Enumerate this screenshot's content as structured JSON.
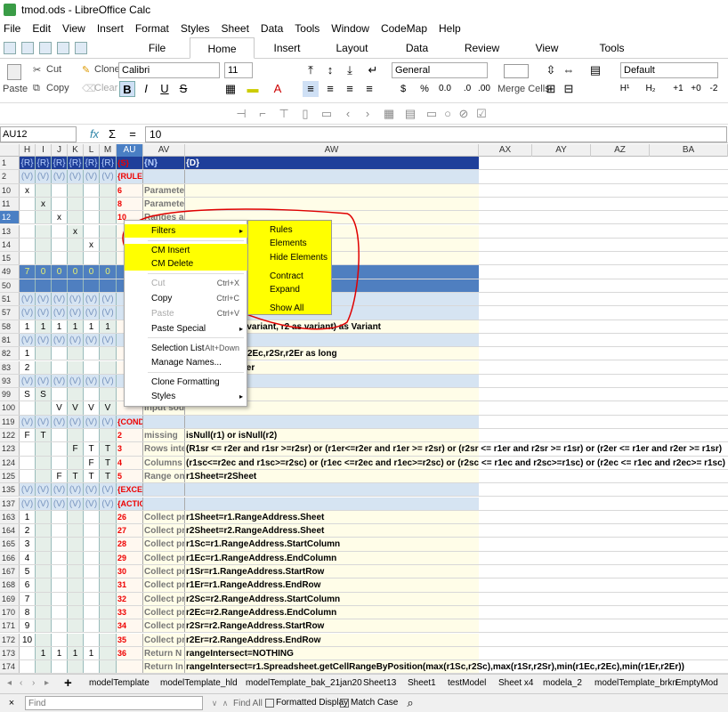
{
  "window": {
    "title": "tmod.ods - LibreOffice Calc"
  },
  "menu": [
    "File",
    "Edit",
    "View",
    "Insert",
    "Format",
    "Styles",
    "Sheet",
    "Data",
    "Tools",
    "Window",
    "CodeMap",
    "Help"
  ],
  "tabs": [
    "File",
    "Home",
    "Insert",
    "Layout",
    "Data",
    "Review",
    "View",
    "Tools"
  ],
  "active_tab": "Home",
  "ribbon": {
    "paste": "Paste",
    "cut": "Cut",
    "copy": "Copy",
    "clone": "Clone",
    "clear": "Clear",
    "font_name": "Calibri",
    "font_size": "11",
    "number_format": "General",
    "style": "Default",
    "merge_cells": "Merge Cells",
    "bold": "B",
    "italic": "I",
    "underline": "U",
    "strike": "S",
    "currency": "$",
    "percent": "%",
    "decimal": "0.0",
    "superscript": "H¹",
    "subscript": "H₂",
    "inc_indent": "+1",
    "dec_indent": "+0",
    "del_decimal": "-2"
  },
  "formula_bar": {
    "cell": "AU12",
    "value": "10",
    "fx": "fx",
    "sum": "Σ",
    "eq": "="
  },
  "columns": [
    "H",
    "I",
    "J",
    "K",
    "L",
    "M",
    "AU",
    "AV",
    "AW",
    "AX",
    "AY",
    "AZ",
    "BA"
  ],
  "rows": [
    {
      "n": "1",
      "cells": [
        "{R}",
        "{R}",
        "{R}",
        "{R}",
        "{R}",
        "{R}"
      ],
      "au": "{S}",
      "av": "{N}",
      "aw": "{D}",
      "style": "blue"
    },
    {
      "n": "2",
      "cells": [
        "(V)",
        "(V)",
        "(V)",
        "(V)",
        "(V)",
        "(V)"
      ],
      "au": "{RULE}",
      "av": "",
      "aw": "",
      "style": "gray"
    },
    {
      "n": "10",
      "cells": [
        "x",
        "",
        "",
        "",
        "",
        ""
      ],
      "au": "6",
      "av": "Parameters all present",
      "aw": "",
      "style": "plain"
    },
    {
      "n": "11",
      "cells": [
        "",
        "x",
        "",
        "",
        "",
        ""
      ],
      "au": "8",
      "av": "Parameter missing",
      "aw": "",
      "style": "plain"
    },
    {
      "n": "12",
      "cells": [
        "",
        "",
        "x",
        "",
        "",
        ""
      ],
      "au": "10",
      "av": "Ranges are on different sheets",
      "aw": "",
      "style": "plain",
      "sel": true
    },
    {
      "n": "13",
      "cells": [
        "",
        "",
        "",
        "x",
        "",
        ""
      ],
      "au": "",
      "av": "",
      "aw": "",
      "style": "plain"
    },
    {
      "n": "14",
      "cells": [
        "",
        "",
        "",
        "",
        "x",
        ""
      ],
      "au": "",
      "av": "",
      "aw": "",
      "style": "plain"
    },
    {
      "n": "15",
      "cells": [
        "",
        "",
        "",
        "",
        "",
        ""
      ],
      "au": "",
      "av": "",
      "aw": "",
      "style": "plain"
    },
    {
      "n": "49",
      "cells": [
        "7",
        "0",
        "0",
        "0",
        "0",
        "0"
      ],
      "au": "",
      "av": "",
      "aw": "",
      "style": "mid"
    },
    {
      "n": "50",
      "cells": [
        "",
        "",
        "",
        "",
        "",
        ""
      ],
      "au": "",
      "av": "",
      "aw": "",
      "style": "mid"
    },
    {
      "n": "51",
      "cells": [
        "(V)",
        "(V)",
        "(V)",
        "(V)",
        "(V)",
        "(V)"
      ],
      "au": "",
      "av": "",
      "aw": "",
      "style": "gray"
    },
    {
      "n": "57",
      "cells": [
        "(V)",
        "(V)",
        "(V)",
        "(V)",
        "(V)",
        "(V)"
      ],
      "au": "",
      "av": "",
      "aw": "",
      "style": "gray"
    },
    {
      "n": "58",
      "cells": [
        "1",
        "1",
        "1",
        "1",
        "1",
        "1"
      ],
      "au": "",
      "av": "",
      "aw": "ntersect(r1 as variant, r2 as variant) as Variant",
      "style": "plain"
    },
    {
      "n": "81",
      "cells": [
        "(V)",
        "(V)",
        "(V)",
        "(V)",
        "(V)",
        "(V)"
      ],
      "au": "",
      "av": "",
      "aw": "",
      "style": "gray"
    },
    {
      "n": "82",
      "cells": [
        "1",
        "",
        "",
        "",
        "",
        ""
      ],
      "au": "",
      "av": "",
      "aw": "1Sr,r1Er,r2Sc,r2Ec,r2Sr,r2Er as long",
      "style": "plain"
    },
    {
      "n": "83",
      "cells": [
        "2",
        "",
        "",
        "",
        "",
        ""
      ],
      "au": "",
      "av": "",
      "aw": "Sheet as integer",
      "style": "plain"
    },
    {
      "n": "93",
      "cells": [
        "(V)",
        "(V)",
        "(V)",
        "(V)",
        "(V)",
        "(V)"
      ],
      "au": "",
      "av": "",
      "aw": "",
      "style": "gray"
    },
    {
      "n": "99",
      "cells": [
        "S",
        "S",
        "",
        "",
        "",
        ""
      ],
      "au": "",
      "av": "",
      "aw": "",
      "style": "plain"
    },
    {
      "n": "100",
      "cells": [
        "",
        "",
        "V",
        "V",
        "V",
        "V"
      ],
      "au": "",
      "av": "Input sound; evaluate ranges",
      "aw": "",
      "style": "plain"
    },
    {
      "n": "119",
      "cells": [
        "(V)",
        "(V)",
        "(V)",
        "(V)",
        "(V)",
        "(V)"
      ],
      "au": "{CONDITION}",
      "av": "",
      "aw": "",
      "style": "gray"
    },
    {
      "n": "122",
      "cells": [
        "F",
        "T",
        "",
        "",
        "",
        ""
      ],
      "au": "2",
      "av": "missing",
      "aw": "isNull(r1) or isNull(r2)",
      "style": "plain"
    },
    {
      "n": "123",
      "cells": [
        "",
        "",
        "",
        "F",
        "T",
        "T"
      ],
      "au": "3",
      "av": "Rows inte",
      "aw": "(R1sr <= r2er and r1sr >=r2sr) or (r1er<=r2er and r1er >= r2sr) or (r2sr <= r1er and r2sr >= r1sr) or (r2er <= r1er and r2er >= r1sr)",
      "style": "plain"
    },
    {
      "n": "124",
      "cells": [
        "",
        "",
        "",
        "",
        "F",
        "T"
      ],
      "au": "4",
      "av": "Columns",
      "aw": "(r1sc<=r2ec and r1sc>=r2sc) or (r1ec <=r2ec and r1ec>=r2sc) or (r2sc <= r1ec and r2sc>=r1sc) or (r2ec <= r1ec and r2ec>= r1sc)",
      "style": "plain"
    },
    {
      "n": "125",
      "cells": [
        "",
        "",
        "F",
        "T",
        "T",
        "T"
      ],
      "au": "5",
      "av": "Range on",
      "aw": "r1Sheet=r2Sheet",
      "style": "plain"
    },
    {
      "n": "135",
      "cells": [
        "(V)",
        "(V)",
        "(V)",
        "(V)",
        "(V)",
        "(V)"
      ],
      "au": "{EXCEPTION}",
      "av": "",
      "aw": "",
      "style": "gray"
    },
    {
      "n": "137",
      "cells": [
        "(V)",
        "(V)",
        "(V)",
        "(V)",
        "(V)",
        "(V)"
      ],
      "au": "{ACTION}",
      "av": "",
      "aw": "",
      "style": "gray"
    },
    {
      "n": "163",
      "cells": [
        "1",
        "",
        "",
        "",
        "",
        ""
      ],
      "au": "26",
      "av": "Collect pr",
      "aw": "r1Sheet=r1.RangeAddress.Sheet",
      "style": "plain"
    },
    {
      "n": "164",
      "cells": [
        "2",
        "",
        "",
        "",
        "",
        ""
      ],
      "au": "27",
      "av": "Collect pr",
      "aw": "r2Sheet=r2.RangeAddress.Sheet",
      "style": "plain"
    },
    {
      "n": "165",
      "cells": [
        "3",
        "",
        "",
        "",
        "",
        ""
      ],
      "au": "28",
      "av": "Collect pr",
      "aw": "r1Sc=r1.RangeAddress.StartColumn",
      "style": "plain"
    },
    {
      "n": "166",
      "cells": [
        "4",
        "",
        "",
        "",
        "",
        ""
      ],
      "au": "29",
      "av": "Collect pr",
      "aw": "r1Ec=r1.RangeAddress.EndColumn",
      "style": "plain"
    },
    {
      "n": "167",
      "cells": [
        "5",
        "",
        "",
        "",
        "",
        ""
      ],
      "au": "30",
      "av": "Collect pr",
      "aw": "r1Sr=r1.RangeAddress.StartRow",
      "style": "plain"
    },
    {
      "n": "168",
      "cells": [
        "6",
        "",
        "",
        "",
        "",
        ""
      ],
      "au": "31",
      "av": "Collect pr",
      "aw": "r1Er=r1.RangeAddress.EndRow",
      "style": "plain"
    },
    {
      "n": "169",
      "cells": [
        "7",
        "",
        "",
        "",
        "",
        ""
      ],
      "au": "32",
      "av": "Collect pr",
      "aw": "r2Sc=r2.RangeAddress.StartColumn",
      "style": "plain"
    },
    {
      "n": "170",
      "cells": [
        "8",
        "",
        "",
        "",
        "",
        ""
      ],
      "au": "33",
      "av": "Collect pr",
      "aw": "r2Ec=r2.RangeAddress.EndColumn",
      "style": "plain"
    },
    {
      "n": "171",
      "cells": [
        "9",
        "",
        "",
        "",
        "",
        ""
      ],
      "au": "34",
      "av": "Collect pr",
      "aw": "r2Sr=r2.RangeAddress.StartRow",
      "style": "plain"
    },
    {
      "n": "172",
      "cells": [
        "10",
        "",
        "",
        "",
        "",
        ""
      ],
      "au": "35",
      "av": "Collect pr",
      "aw": "r2Er=r2.RangeAddress.EndRow",
      "style": "plain"
    },
    {
      "n": "173",
      "cells": [
        "",
        "1",
        "1",
        "1",
        "1",
        ""
      ],
      "au": "36",
      "av": "Return N",
      "aw": "rangeIntersect=NOTHING",
      "style": "plain"
    },
    {
      "n": "174",
      "cells": [
        "",
        "",
        "",
        "",
        "",
        ""
      ],
      "au": "",
      "av": "Return In",
      "aw": "rangeIntersect=r1.Spreadsheet.getCellRangeByPosition(max(r1Sc,r2Sc),max(r1Sr,r2Sr),min(r1Ec,r2Ec),min(r1Er,r2Er))",
      "style": "plain"
    }
  ],
  "context_menu": {
    "items": [
      {
        "label": "Filters",
        "shortcut": "",
        "sub": true,
        "hl": true
      },
      {
        "label": "CM Insert",
        "shortcut": "",
        "sub": false,
        "hl": true
      },
      {
        "label": "CM Delete",
        "shortcut": "",
        "sub": false,
        "hl": true
      },
      {
        "label": "Cut",
        "shortcut": "Ctrl+X",
        "sub": false,
        "dis": true
      },
      {
        "label": "Copy",
        "shortcut": "Ctrl+C",
        "sub": false
      },
      {
        "label": "Paste",
        "shortcut": "Ctrl+V",
        "sub": false,
        "dis": true
      },
      {
        "label": "Paste Special",
        "shortcut": "",
        "sub": true
      },
      {
        "label": "Selection List",
        "shortcut": "Alt+Down",
        "sub": false
      },
      {
        "label": "Manage Names...",
        "shortcut": "",
        "sub": false
      },
      {
        "label": "Clone Formatting",
        "shortcut": "",
        "sub": false
      },
      {
        "label": "Styles",
        "shortcut": "",
        "sub": true
      }
    ]
  },
  "submenu": [
    "Rules",
    "Elements",
    "Hide Elements",
    "Contract",
    "Expand",
    "Show All"
  ],
  "sheet_tabs": [
    "modelTemplate",
    "modelTemplate_hld",
    "modelTemplate_bak_21jan20",
    "Sheet13",
    "Sheet1",
    "testModel",
    "Sheet x4",
    "modela_2",
    "modelTemplate_brkn",
    "EmptyMod"
  ],
  "findbar": {
    "placeholder": "Find",
    "find_all": "Find All",
    "formatted": "Formatted Display",
    "match_case": "Match Case"
  },
  "colors": {
    "accent": "#4a7fc4",
    "highlight": "#ffff00",
    "annotation": "#e00000"
  }
}
